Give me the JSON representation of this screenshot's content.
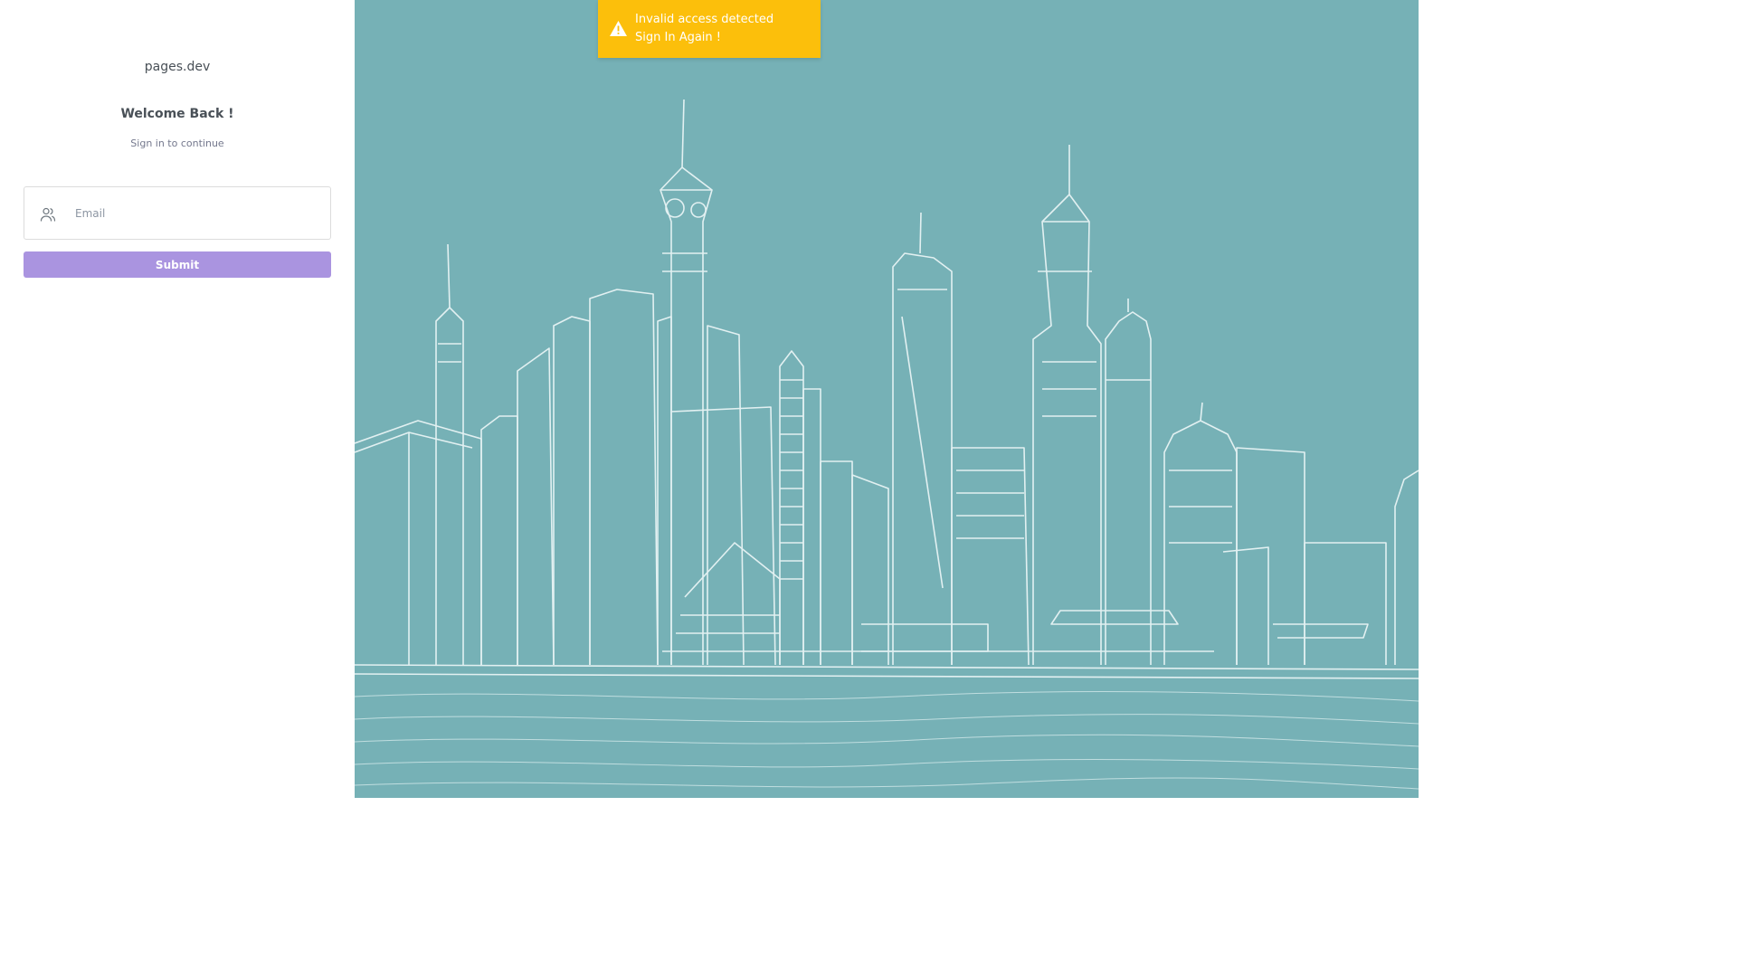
{
  "brand": {
    "name": "pages.dev"
  },
  "auth": {
    "heading": "Welcome Back !",
    "subtitle": "Sign in to continue",
    "email_placeholder": "Email",
    "email_icon": "users-icon",
    "submit_label": "Submit"
  },
  "toast": {
    "icon": "warning-triangle-icon",
    "title": "Invalid access detected",
    "message": "Sign In Again !"
  },
  "hero": {
    "illustration": "city-skyline-sketch",
    "background_color": "#76b1b6"
  },
  "colors": {
    "accent": "#aa94e0",
    "warning": "#fcbf0b",
    "text_primary": "#495057",
    "text_muted": "#74788d"
  }
}
